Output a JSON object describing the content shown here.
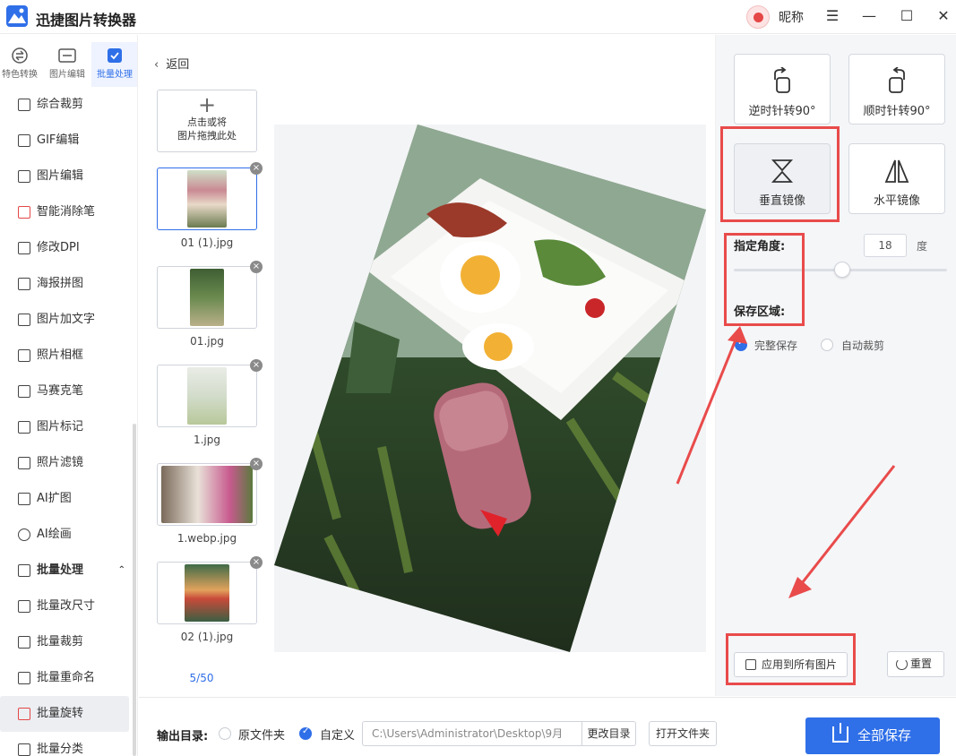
{
  "app": {
    "title": "迅捷图片转换器",
    "nickname": "昵称"
  },
  "window_controls": {
    "menu": "☰",
    "minimize": "—",
    "maximize": "☐",
    "close": "✕"
  },
  "side_tabs": [
    {
      "label": "特色转换",
      "icon": "swap-circle-icon"
    },
    {
      "label": "图片编辑",
      "icon": "image-edit-icon"
    },
    {
      "label": "批量处理",
      "icon": "checkbox-icon",
      "active": true
    }
  ],
  "menu": {
    "items": [
      {
        "label": "综合裁剪",
        "icon": "crop-icon"
      },
      {
        "label": "GIF编辑",
        "icon": "gif-icon"
      },
      {
        "label": "图片编辑",
        "icon": "image-icon"
      },
      {
        "label": "智能消除笔",
        "icon": "eraser-pen-icon"
      },
      {
        "label": "修改DPI",
        "icon": "hd-icon"
      },
      {
        "label": "海报拼图",
        "icon": "collage-icon"
      },
      {
        "label": "图片加文字",
        "icon": "text-image-icon"
      },
      {
        "label": "照片相框",
        "icon": "frame-icon"
      },
      {
        "label": "马赛克笔",
        "icon": "mosaic-icon"
      },
      {
        "label": "图片标记",
        "icon": "mark-icon"
      },
      {
        "label": "照片滤镜",
        "icon": "filter-icon"
      },
      {
        "label": "AI扩图",
        "icon": "ai-expand-icon"
      },
      {
        "label": "AI绘画",
        "icon": "palette-icon"
      }
    ],
    "group": {
      "label": "批量处理",
      "icon": "checkbox-icon",
      "chevron": "⌃"
    },
    "sub_items": [
      {
        "label": "批量改尺寸",
        "icon": "resize-icon"
      },
      {
        "label": "批量裁剪",
        "icon": "crop-icon"
      },
      {
        "label": "批量重命名",
        "icon": "rename-icon"
      },
      {
        "label": "批量旋转",
        "icon": "rotate-icon",
        "selected": true
      },
      {
        "label": "批量分类",
        "icon": "classify-icon"
      }
    ]
  },
  "file_panel": {
    "back_label": "返回",
    "upload": {
      "line1": "点击或将",
      "line2": "图片拖拽此处"
    },
    "files": [
      {
        "name": "01 (1).jpg",
        "active": true,
        "color": "#c9a28a"
      },
      {
        "name": "01.jpg",
        "color": "#4f6b3f"
      },
      {
        "name": "1.jpg",
        "color": "#d9e0d2"
      },
      {
        "name": "1.webp.jpg",
        "color": "#c85a8a"
      },
      {
        "name": "02 (1).jpg",
        "color": "#3f6a48"
      }
    ],
    "page_count": "5/50"
  },
  "tools": {
    "rotate_ccw": "逆时针转90°",
    "rotate_cw": "顺时针转90°",
    "flip_vertical": "垂直镜像",
    "flip_horizontal": "水平镜像",
    "angle_label": "指定角度:",
    "angle_value": "18",
    "angle_unit": "度",
    "angle_slider_fraction": 0.51,
    "save_area_label": "保存区域:",
    "save_options": [
      {
        "label": "完整保存",
        "checked": true
      },
      {
        "label": "自动裁剪",
        "checked": false
      }
    ],
    "apply_all": "应用到所有图片",
    "reset": "重置"
  },
  "output": {
    "label": "输出目录:",
    "options": [
      {
        "label": "原文件夹",
        "checked": false
      },
      {
        "label": "自定义",
        "checked": true
      }
    ],
    "path": "C:\\Users\\Administrator\\Desktop\\9月",
    "change_dir": "更改目录",
    "open_folder": "打开文件夹",
    "save_all": "全部保存"
  },
  "colors": {
    "accent": "#2f6fe8",
    "annotation_red": "#e94b4b"
  }
}
